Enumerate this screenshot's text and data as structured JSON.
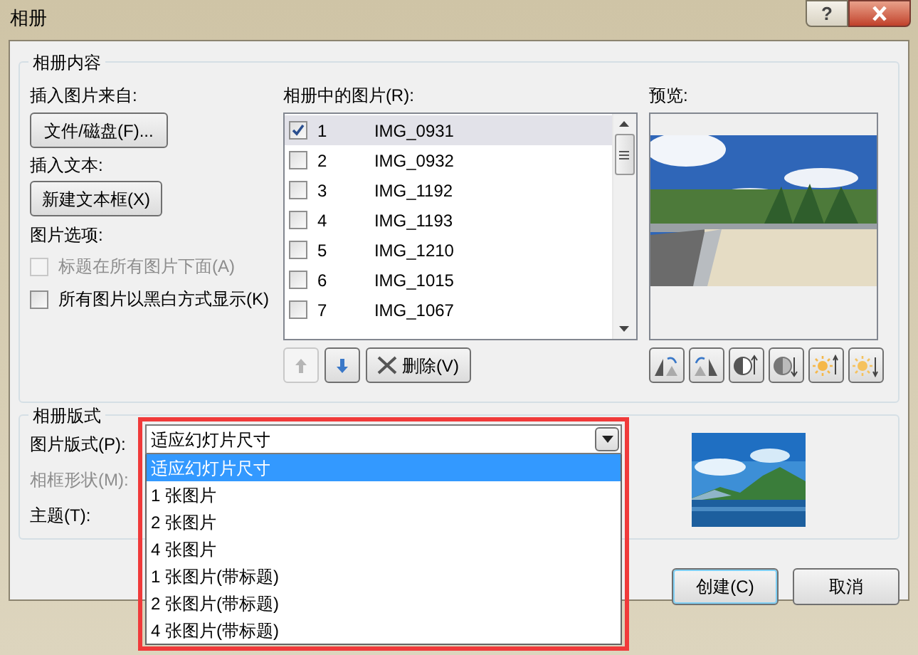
{
  "window": {
    "title": "相册",
    "help": "?"
  },
  "album_content": {
    "title": "相册内容",
    "insert_from": {
      "label": "插入图片来自:",
      "button": "文件/磁盘(F)..."
    },
    "insert_text": {
      "label": "插入文本:",
      "button": "新建文本框(X)"
    },
    "picture_options": {
      "label": "图片选项:",
      "options": [
        {
          "label": "标题在所有图片下面(A)",
          "checked": false,
          "disabled": true
        },
        {
          "label": "所有图片以黑白方式显示(K)",
          "checked": false,
          "disabled": false
        }
      ]
    },
    "pictures": {
      "label": "相册中的图片(R):",
      "items": [
        {
          "number": "1",
          "name": "IMG_0931",
          "checked": true,
          "selected": true
        },
        {
          "number": "2",
          "name": "IMG_0932",
          "checked": false,
          "selected": false
        },
        {
          "number": "3",
          "name": "IMG_1192",
          "checked": false,
          "selected": false
        },
        {
          "number": "4",
          "name": "IMG_1193",
          "checked": false,
          "selected": false
        },
        {
          "number": "5",
          "name": "IMG_1210",
          "checked": false,
          "selected": false
        },
        {
          "number": "6",
          "name": "IMG_1015",
          "checked": false,
          "selected": false
        },
        {
          "number": "7",
          "name": "IMG_1067",
          "checked": false,
          "selected": false
        }
      ]
    },
    "list_buttons": [
      {
        "kind": "up",
        "disabled": true
      },
      {
        "kind": "down",
        "disabled": false
      },
      {
        "kind": "delete",
        "label": "删除(V)",
        "disabled": false
      }
    ],
    "preview": {
      "label": "预览:"
    },
    "image_tools": [
      {
        "kind": "rotate-left"
      },
      {
        "kind": "rotate-right"
      },
      {
        "kind": "contrast-up"
      },
      {
        "kind": "contrast-down"
      },
      {
        "kind": "brightness-up"
      },
      {
        "kind": "brightness-down"
      }
    ]
  },
  "album_layout": {
    "title": "相册版式",
    "fields": [
      {
        "label": "图片版式(P):",
        "disabled": false
      },
      {
        "label": "相框形状(M):",
        "disabled": true
      },
      {
        "label": "主题(T):",
        "disabled": false
      }
    ],
    "picture_layout": {
      "value": "适应幻灯片尺寸",
      "options": [
        {
          "label": "适应幻灯片尺寸",
          "selected": true
        },
        {
          "label": "1 张图片",
          "selected": false
        },
        {
          "label": "2 张图片",
          "selected": false
        },
        {
          "label": "4 张图片",
          "selected": false
        },
        {
          "label": "1 张图片(带标题)",
          "selected": false
        },
        {
          "label": "2 张图片(带标题)",
          "selected": false
        },
        {
          "label": "4 张图片(带标题)",
          "selected": false
        }
      ]
    }
  },
  "buttons": [
    {
      "label": "创建(C)",
      "default": true
    },
    {
      "label": "取消",
      "default": false
    }
  ]
}
